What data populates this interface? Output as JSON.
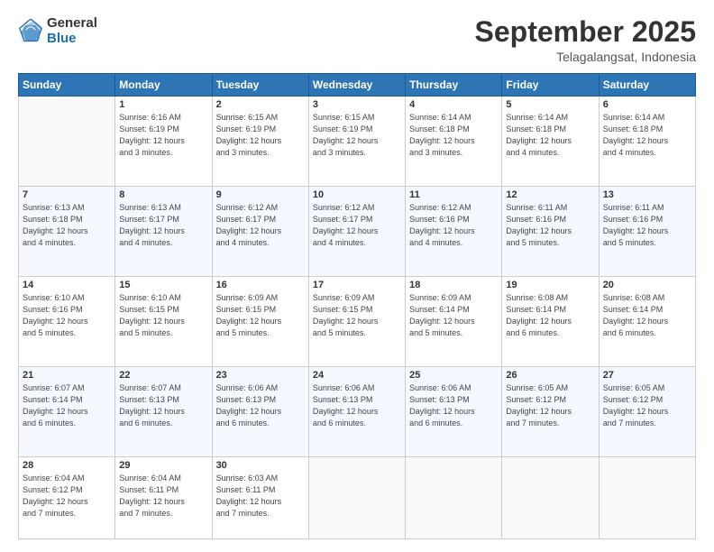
{
  "logo": {
    "general": "General",
    "blue": "Blue"
  },
  "header": {
    "month": "September 2025",
    "location": "Telagalangsat, Indonesia"
  },
  "days_of_week": [
    "Sunday",
    "Monday",
    "Tuesday",
    "Wednesday",
    "Thursday",
    "Friday",
    "Saturday"
  ],
  "weeks": [
    [
      {
        "day": "",
        "info": ""
      },
      {
        "day": "1",
        "info": "Sunrise: 6:16 AM\nSunset: 6:19 PM\nDaylight: 12 hours\nand 3 minutes."
      },
      {
        "day": "2",
        "info": "Sunrise: 6:15 AM\nSunset: 6:19 PM\nDaylight: 12 hours\nand 3 minutes."
      },
      {
        "day": "3",
        "info": "Sunrise: 6:15 AM\nSunset: 6:19 PM\nDaylight: 12 hours\nand 3 minutes."
      },
      {
        "day": "4",
        "info": "Sunrise: 6:14 AM\nSunset: 6:18 PM\nDaylight: 12 hours\nand 3 minutes."
      },
      {
        "day": "5",
        "info": "Sunrise: 6:14 AM\nSunset: 6:18 PM\nDaylight: 12 hours\nand 4 minutes."
      },
      {
        "day": "6",
        "info": "Sunrise: 6:14 AM\nSunset: 6:18 PM\nDaylight: 12 hours\nand 4 minutes."
      }
    ],
    [
      {
        "day": "7",
        "info": "Sunrise: 6:13 AM\nSunset: 6:18 PM\nDaylight: 12 hours\nand 4 minutes."
      },
      {
        "day": "8",
        "info": "Sunrise: 6:13 AM\nSunset: 6:17 PM\nDaylight: 12 hours\nand 4 minutes."
      },
      {
        "day": "9",
        "info": "Sunrise: 6:12 AM\nSunset: 6:17 PM\nDaylight: 12 hours\nand 4 minutes."
      },
      {
        "day": "10",
        "info": "Sunrise: 6:12 AM\nSunset: 6:17 PM\nDaylight: 12 hours\nand 4 minutes."
      },
      {
        "day": "11",
        "info": "Sunrise: 6:12 AM\nSunset: 6:16 PM\nDaylight: 12 hours\nand 4 minutes."
      },
      {
        "day": "12",
        "info": "Sunrise: 6:11 AM\nSunset: 6:16 PM\nDaylight: 12 hours\nand 5 minutes."
      },
      {
        "day": "13",
        "info": "Sunrise: 6:11 AM\nSunset: 6:16 PM\nDaylight: 12 hours\nand 5 minutes."
      }
    ],
    [
      {
        "day": "14",
        "info": "Sunrise: 6:10 AM\nSunset: 6:16 PM\nDaylight: 12 hours\nand 5 minutes."
      },
      {
        "day": "15",
        "info": "Sunrise: 6:10 AM\nSunset: 6:15 PM\nDaylight: 12 hours\nand 5 minutes."
      },
      {
        "day": "16",
        "info": "Sunrise: 6:09 AM\nSunset: 6:15 PM\nDaylight: 12 hours\nand 5 minutes."
      },
      {
        "day": "17",
        "info": "Sunrise: 6:09 AM\nSunset: 6:15 PM\nDaylight: 12 hours\nand 5 minutes."
      },
      {
        "day": "18",
        "info": "Sunrise: 6:09 AM\nSunset: 6:14 PM\nDaylight: 12 hours\nand 5 minutes."
      },
      {
        "day": "19",
        "info": "Sunrise: 6:08 AM\nSunset: 6:14 PM\nDaylight: 12 hours\nand 6 minutes."
      },
      {
        "day": "20",
        "info": "Sunrise: 6:08 AM\nSunset: 6:14 PM\nDaylight: 12 hours\nand 6 minutes."
      }
    ],
    [
      {
        "day": "21",
        "info": "Sunrise: 6:07 AM\nSunset: 6:14 PM\nDaylight: 12 hours\nand 6 minutes."
      },
      {
        "day": "22",
        "info": "Sunrise: 6:07 AM\nSunset: 6:13 PM\nDaylight: 12 hours\nand 6 minutes."
      },
      {
        "day": "23",
        "info": "Sunrise: 6:06 AM\nSunset: 6:13 PM\nDaylight: 12 hours\nand 6 minutes."
      },
      {
        "day": "24",
        "info": "Sunrise: 6:06 AM\nSunset: 6:13 PM\nDaylight: 12 hours\nand 6 minutes."
      },
      {
        "day": "25",
        "info": "Sunrise: 6:06 AM\nSunset: 6:13 PM\nDaylight: 12 hours\nand 6 minutes."
      },
      {
        "day": "26",
        "info": "Sunrise: 6:05 AM\nSunset: 6:12 PM\nDaylight: 12 hours\nand 7 minutes."
      },
      {
        "day": "27",
        "info": "Sunrise: 6:05 AM\nSunset: 6:12 PM\nDaylight: 12 hours\nand 7 minutes."
      }
    ],
    [
      {
        "day": "28",
        "info": "Sunrise: 6:04 AM\nSunset: 6:12 PM\nDaylight: 12 hours\nand 7 minutes."
      },
      {
        "day": "29",
        "info": "Sunrise: 6:04 AM\nSunset: 6:11 PM\nDaylight: 12 hours\nand 7 minutes."
      },
      {
        "day": "30",
        "info": "Sunrise: 6:03 AM\nSunset: 6:11 PM\nDaylight: 12 hours\nand 7 minutes."
      },
      {
        "day": "",
        "info": ""
      },
      {
        "day": "",
        "info": ""
      },
      {
        "day": "",
        "info": ""
      },
      {
        "day": "",
        "info": ""
      }
    ]
  ]
}
